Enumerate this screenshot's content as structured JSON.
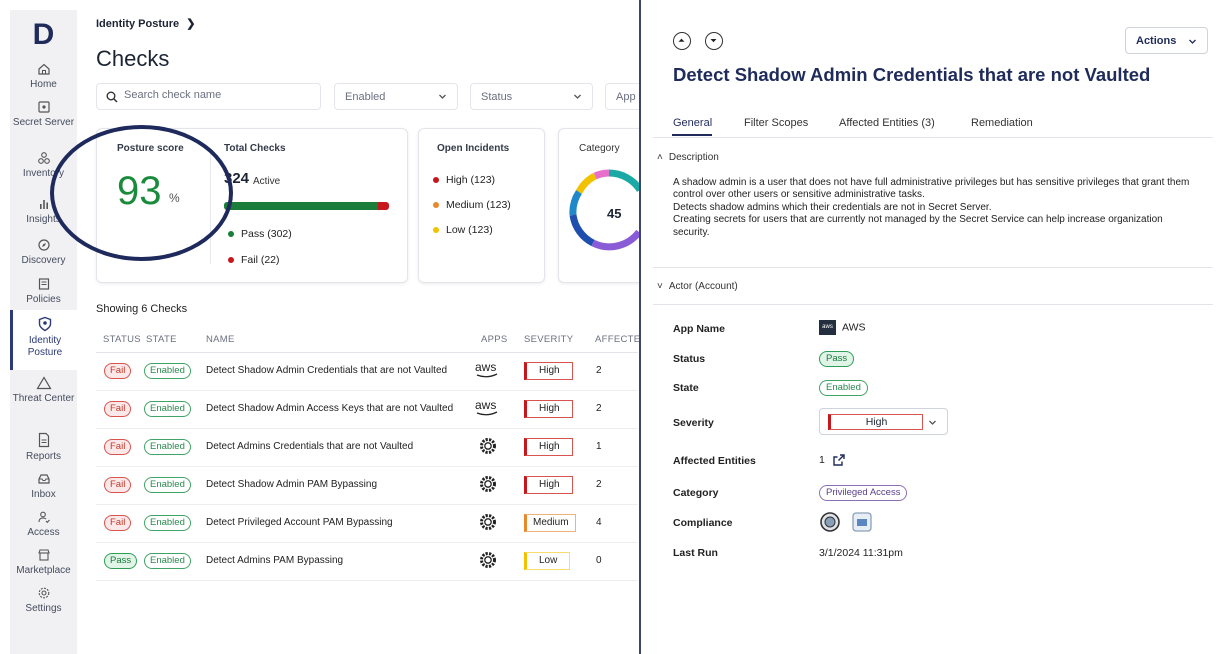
{
  "brand": {
    "logo_letter": "D"
  },
  "nav": {
    "items": [
      {
        "label": "Home",
        "icon": "home-icon"
      },
      {
        "label": "Secret Server",
        "icon": "secret-server-icon"
      },
      {
        "label": "Inventory",
        "icon": "inventory-icon"
      },
      {
        "label": "Insights",
        "icon": "insights-icon"
      },
      {
        "label": "Discovery",
        "icon": "discovery-icon"
      },
      {
        "label": "Policies",
        "icon": "policies-icon"
      },
      {
        "label": "Identity Posture",
        "icon": "identity-posture-icon",
        "active": true
      },
      {
        "label": "Threat Center",
        "icon": "threat-center-icon"
      },
      {
        "label": "Reports",
        "icon": "reports-icon"
      },
      {
        "label": "Inbox",
        "icon": "inbox-icon"
      },
      {
        "label": "Access",
        "icon": "access-icon"
      },
      {
        "label": "Marketplace",
        "icon": "marketplace-icon"
      },
      {
        "label": "Settings",
        "icon": "settings-icon"
      }
    ]
  },
  "page": {
    "breadcrumb": "Identity Posture",
    "title": "Checks",
    "search_placeholder": "Search check name",
    "filters": {
      "state": "Enabled",
      "status": "Status",
      "apps": "App"
    }
  },
  "cards": {
    "posture": {
      "title": "Posture score",
      "value": "93",
      "unit": "%"
    },
    "total": {
      "title": "Total Checks",
      "count": "324",
      "active_label": "Active",
      "pass_label": "Pass (302)",
      "fail_label": "Fail (22)",
      "pass_count": 302,
      "fail_count": 22
    },
    "incidents": {
      "title": "Open Incidents",
      "high": "High (123)",
      "medium": "Medium (123)",
      "low": "Low (123)"
    },
    "category": {
      "title": "Category",
      "value": "45"
    }
  },
  "table": {
    "showing": "Showing 6 Checks",
    "headers": [
      "STATUS",
      "STATE",
      "NAME",
      "APPS",
      "SEVERITY",
      "AFFECTED"
    ],
    "rows": [
      {
        "status": "Fail",
        "state": "Enabled",
        "name": "Detect Shadow Admin Credentials that are not Vaulted",
        "app": "aws",
        "severity": "High",
        "affected": "2"
      },
      {
        "status": "Fail",
        "state": "Enabled",
        "name": "Detect Shadow Admin Access Keys that are not Vaulted",
        "app": "aws",
        "severity": "High",
        "affected": "2"
      },
      {
        "status": "Fail",
        "state": "Enabled",
        "name": "Detect Admins Credentials that are not Vaulted",
        "app": "gear-app",
        "severity": "High",
        "affected": "1"
      },
      {
        "status": "Fail",
        "state": "Enabled",
        "name": "Detect Shadow Admin PAM Bypassing",
        "app": "gear-app",
        "severity": "High",
        "affected": "2"
      },
      {
        "status": "Fail",
        "state": "Enabled",
        "name": "Detect Privileged Account PAM Bypassing",
        "app": "gear-app",
        "severity": "Medium",
        "affected": "4"
      },
      {
        "status": "Pass",
        "state": "Enabled",
        "name": "Detect Admins PAM Bypassing",
        "app": "gear-app",
        "severity": "Low",
        "affected": "0"
      }
    ]
  },
  "drawer": {
    "actions_label": "Actions",
    "title": "Detect Shadow Admin Credentials that are not Vaulted",
    "tabs": [
      "General",
      "Filter Scopes",
      "Affected Entities (3)",
      "Remediation"
    ],
    "description_heading": "Description",
    "description": [
      "A shadow admin is a user that does not have full administrative privileges but has sensitive privileges that grant them control over other users or sensitive administrative tasks.",
      "Detects shadow admins which their credentials are not in Secret Server.",
      "Creating secrets for users that are currently not managed by the Secret Service can help increase organization security."
    ],
    "actor_heading": "Actor (Account)",
    "fields": {
      "app_name_label": "App Name",
      "app_name": "AWS",
      "app_logo_text": "aws",
      "status_label": "Status",
      "status": "Pass",
      "state_label": "State",
      "state": "Enabled",
      "severity_label": "Severity",
      "severity": "High",
      "affected_label": "Affected Entities",
      "affected": "1",
      "category_label": "Category",
      "category": "Privileged Access",
      "compliance_label": "Compliance",
      "last_run_label": "Last Run",
      "last_run": "3/1/2024 11:31pm"
    }
  },
  "colors": {
    "pass": "#1a7d3a",
    "fail": "#c7161c",
    "medium": "#e8892b",
    "low": "#f2c200",
    "brand": "#1f2b5b"
  }
}
